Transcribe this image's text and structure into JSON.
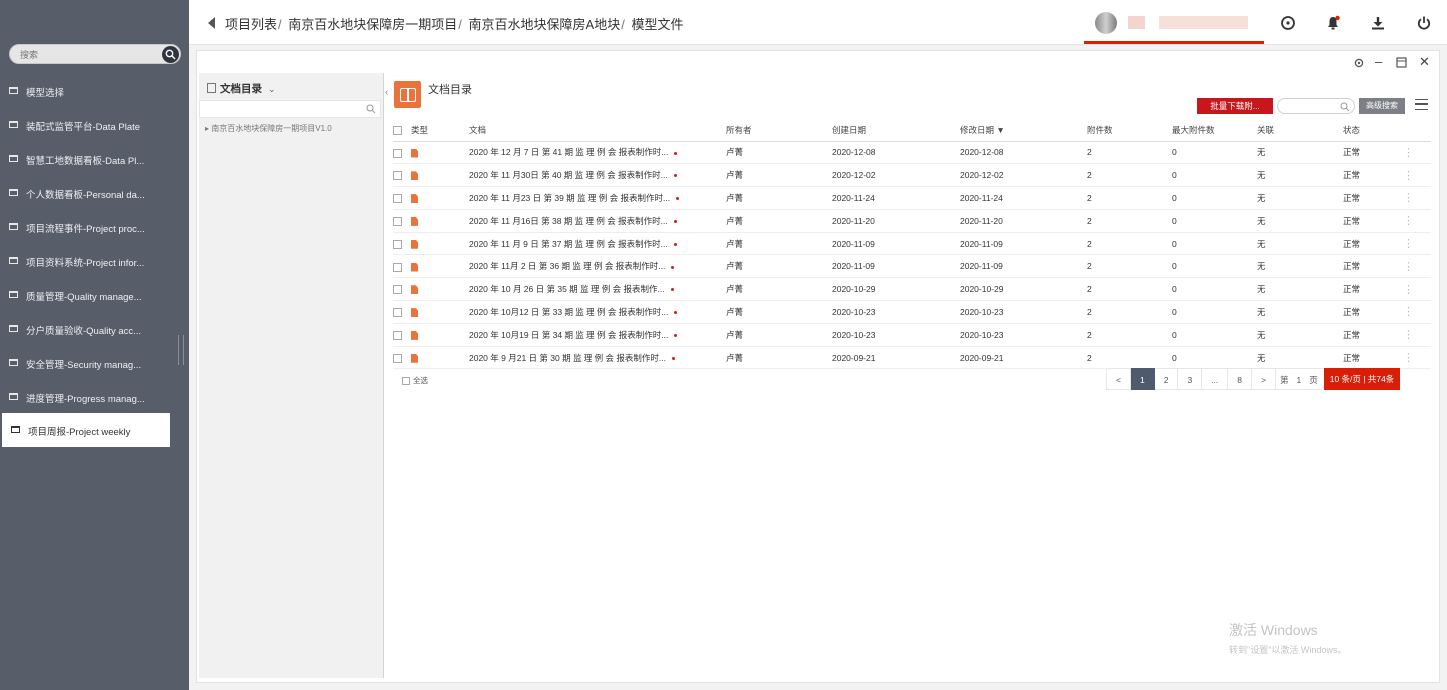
{
  "sidebar": {
    "search_placeholder": "搜索",
    "items": [
      {
        "label": "模型选择"
      },
      {
        "label": "装配式监管平台-Data Plate"
      },
      {
        "label": "智慧工地数据看板-Data Pl..."
      },
      {
        "label": "个人数据看板-Personal da..."
      },
      {
        "label": "项目流程事件-Project proc..."
      },
      {
        "label": "项目资料系统-Project infor..."
      },
      {
        "label": "质量管理-Quality manage..."
      },
      {
        "label": "分户质量验收-Quality acc..."
      },
      {
        "label": "安全管理-Security manag..."
      },
      {
        "label": "进度管理-Progress manag..."
      },
      {
        "label": "项目周报-Project weekly"
      }
    ]
  },
  "header": {
    "breadcrumbs": [
      "项目列表",
      "南京百水地块保障房一期项目",
      "南京百水地块保障房A地块",
      "模型文件"
    ]
  },
  "tree": {
    "title": "文档目录",
    "search_placeholder": "",
    "node": "南京百水地块保障房一期项目V1.0"
  },
  "content": {
    "title": "文档目录",
    "batch_download": "批量下载附...",
    "search_placeholder": "",
    "advanced_search": "高级搜索"
  },
  "table": {
    "headers": [
      "类型",
      "文档",
      "所有者",
      "创建日期",
      "修改日期 ▼",
      "附件数",
      "最大附件数",
      "关联",
      "状态"
    ],
    "rows": [
      {
        "name": "2020 年 12 月 7 日 第 41 期 监 理 例 会 报表制作时...",
        "owner": "卢菁",
        "created": "2020-12-08",
        "modified": "2020-12-08",
        "attachments": "2",
        "max": "0",
        "related": "无",
        "status": "正常"
      },
      {
        "name": "2020 年 11 月30日 第 40 期 监 理 例 会 报表制作时...",
        "owner": "卢菁",
        "created": "2020-12-02",
        "modified": "2020-12-02",
        "attachments": "2",
        "max": "0",
        "related": "无",
        "status": "正常"
      },
      {
        "name": "2020 年 11 月23 日 第 39 期 监 理 例 会 报表制作时...",
        "owner": "卢菁",
        "created": "2020-11-24",
        "modified": "2020-11-24",
        "attachments": "2",
        "max": "0",
        "related": "无",
        "status": "正常"
      },
      {
        "name": "2020 年 11 月16日 第 38 期 监 理 例 会 报表制作时...",
        "owner": "卢菁",
        "created": "2020-11-20",
        "modified": "2020-11-20",
        "attachments": "2",
        "max": "0",
        "related": "无",
        "status": "正常"
      },
      {
        "name": "2020 年 11 月 9 日 第 37 期 监 理 例 会 报表制作时...",
        "owner": "卢菁",
        "created": "2020-11-09",
        "modified": "2020-11-09",
        "attachments": "2",
        "max": "0",
        "related": "无",
        "status": "正常"
      },
      {
        "name": "2020 年 11月 2 日 第 36 期 监 理 例 会 报表制作时...",
        "owner": "卢菁",
        "created": "2020-11-09",
        "modified": "2020-11-09",
        "attachments": "2",
        "max": "0",
        "related": "无",
        "status": "正常"
      },
      {
        "name": "2020 年 10 月 26 日 第 35 期 监 理 例 会 报表制作...",
        "owner": "卢菁",
        "created": "2020-10-29",
        "modified": "2020-10-29",
        "attachments": "2",
        "max": "0",
        "related": "无",
        "status": "正常"
      },
      {
        "name": "2020 年 10月12 日 第 33 期 监 理 例 会 报表制作时...",
        "owner": "卢菁",
        "created": "2020-10-23",
        "modified": "2020-10-23",
        "attachments": "2",
        "max": "0",
        "related": "无",
        "status": "正常"
      },
      {
        "name": "2020 年 10月19 日 第 34 期 监 理 例 会 报表制作时...",
        "owner": "卢菁",
        "created": "2020-10-23",
        "modified": "2020-10-23",
        "attachments": "2",
        "max": "0",
        "related": "无",
        "status": "正常"
      },
      {
        "name": "2020 年 9 月21 日 第 30 期 监 理 例 会 报表制作时...",
        "owner": "卢菁",
        "created": "2020-09-21",
        "modified": "2020-09-21",
        "attachments": "2",
        "max": "0",
        "related": "无",
        "status": "正常"
      }
    ],
    "select_all": "全选"
  },
  "pagination": {
    "prev": "<",
    "pages": [
      "1",
      "2",
      "3"
    ],
    "ellipsis": "...",
    "last_page": "8",
    "next": ">",
    "goto_prefix": "第",
    "goto_value": "1",
    "goto_suffix": "页",
    "per_page": "10 条/页 | 共74条"
  },
  "watermark": {
    "line1": "激活 Windows",
    "line2": "转到\"设置\"以激活 Windows。"
  },
  "colors": {
    "sidebar_bg": "#575d69",
    "accent_red": "#d81e06",
    "file_orange": "#e8743b",
    "page_current": "#4f5b6c"
  }
}
